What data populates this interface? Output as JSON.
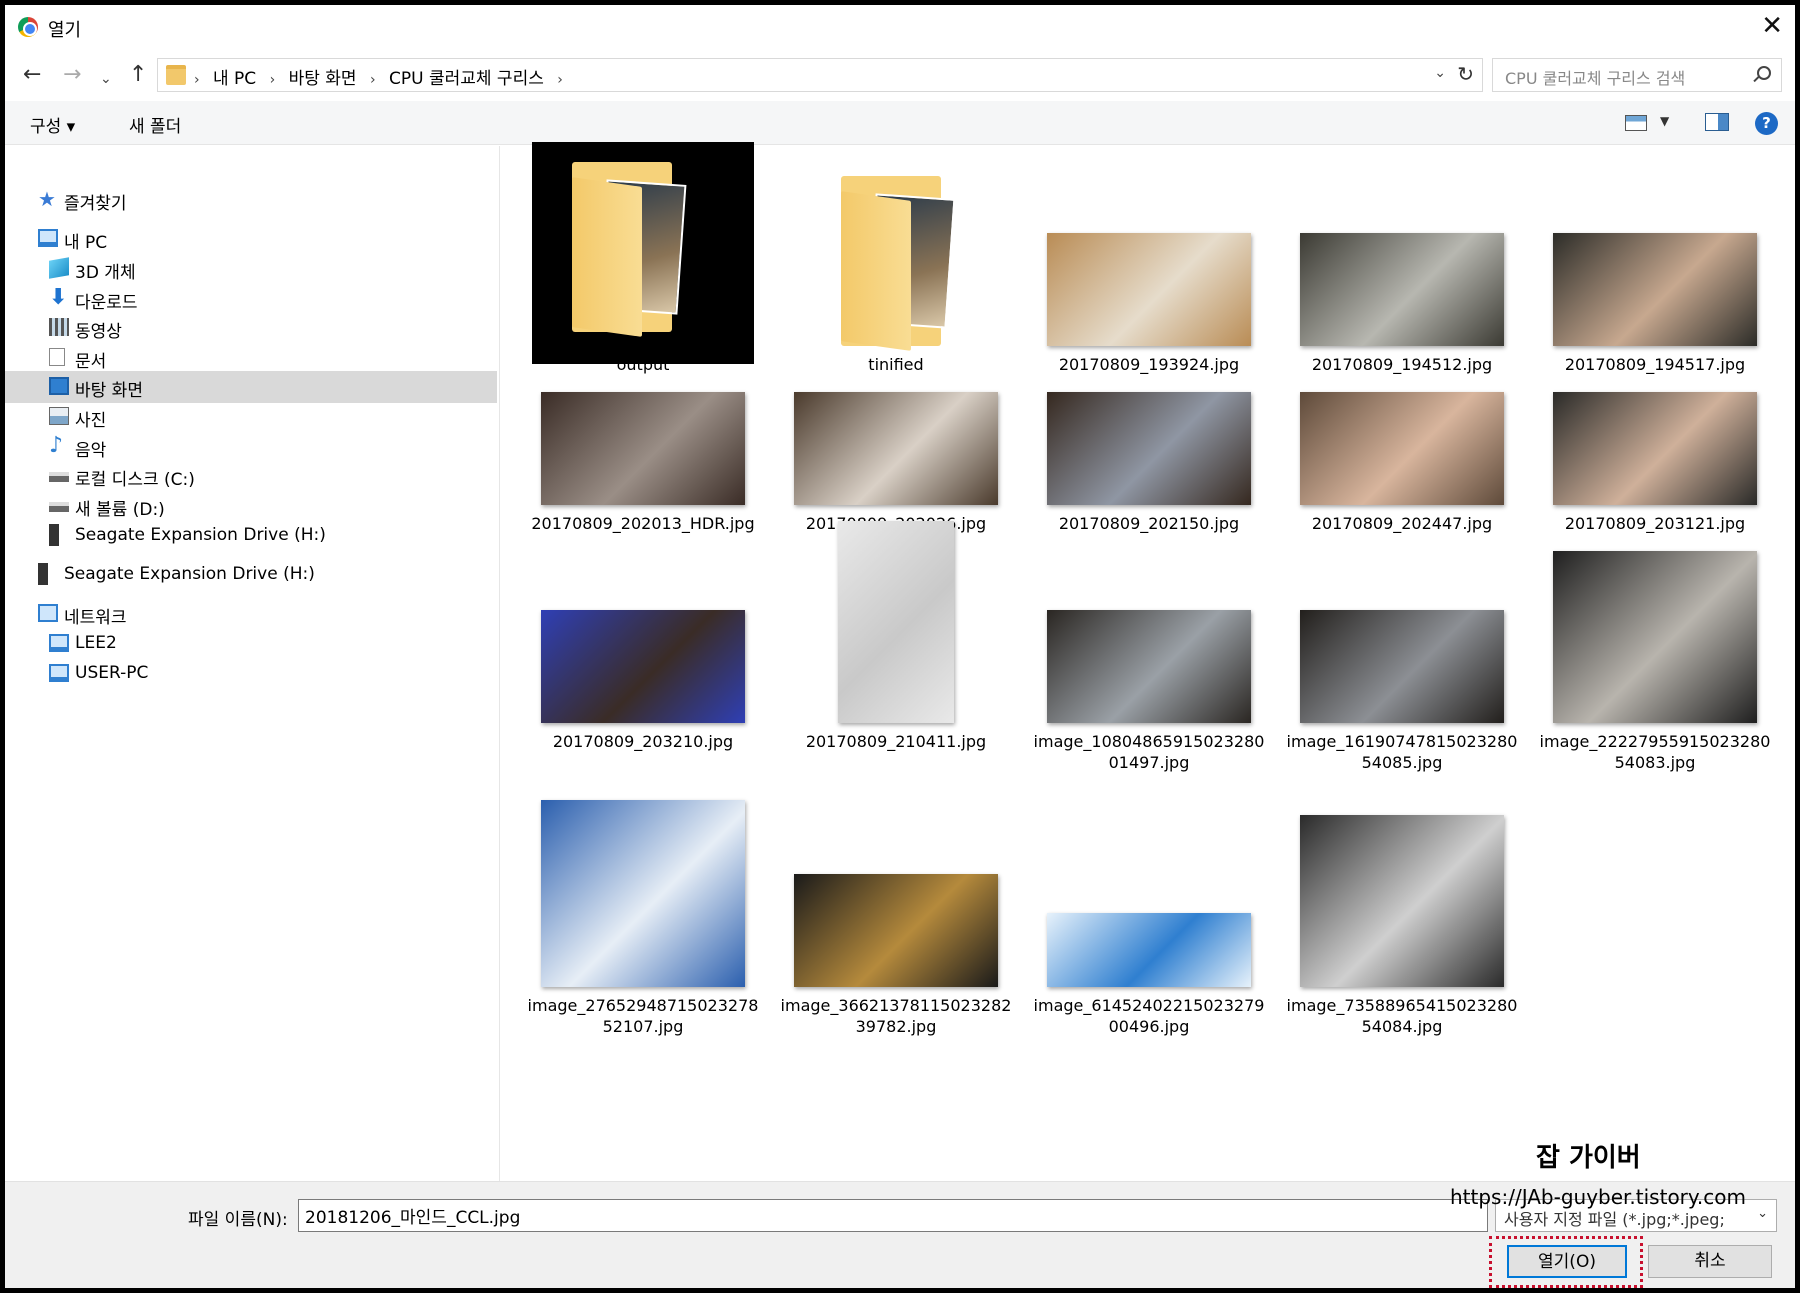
{
  "window": {
    "title": "열기",
    "app_icon": "chrome-icon",
    "close_glyph": "✕"
  },
  "address_bar": {
    "crumbs": [
      "내 PC",
      "바탕 화면",
      "CPU 쿨러교체 구리스"
    ],
    "separator": "›",
    "search_placeholder": "CPU 쿨러교체 구리스 검색"
  },
  "toolbar": {
    "organize_label": "구성 ▾",
    "new_folder_label": "새 폴더",
    "help_glyph": "?"
  },
  "sidebar": {
    "items": [
      {
        "label": "즐겨찾기",
        "icon": "star-icon",
        "indent": 0
      },
      {
        "label": "내 PC",
        "icon": "computer-icon",
        "indent": 0
      },
      {
        "label": "3D 개체",
        "icon": "3d-objects-icon",
        "indent": 1
      },
      {
        "label": "다운로드",
        "icon": "download-icon",
        "indent": 1
      },
      {
        "label": "동영상",
        "icon": "video-icon",
        "indent": 1
      },
      {
        "label": "문서",
        "icon": "document-icon",
        "indent": 1
      },
      {
        "label": "바탕 화면",
        "icon": "desktop-icon",
        "indent": 1,
        "selected": true
      },
      {
        "label": "사진",
        "icon": "pictures-icon",
        "indent": 1
      },
      {
        "label": "음악",
        "icon": "music-icon",
        "indent": 1
      },
      {
        "label": "로컬 디스크 (C:)",
        "icon": "disk-icon",
        "indent": 1
      },
      {
        "label": "새 볼륨 (D:)",
        "icon": "disk-icon",
        "indent": 1
      },
      {
        "label": "Seagate Expansion Drive (H:)",
        "icon": "drive-icon",
        "indent": 1
      },
      {
        "label": "Seagate Expansion Drive (H:)",
        "icon": "drive-icon",
        "indent": 0
      },
      {
        "label": "네트워크",
        "icon": "network-icon",
        "indent": 0
      },
      {
        "label": "LEE2",
        "icon": "computer-icon",
        "indent": 1
      },
      {
        "label": "USER-PC",
        "icon": "computer-icon",
        "indent": 1
      }
    ]
  },
  "files": [
    {
      "name": "output",
      "type": "folder",
      "dark": true
    },
    {
      "name": "tinified",
      "type": "folder"
    },
    {
      "name": "20170809_193924.jpg",
      "type": "image",
      "colors": [
        "#b98c55",
        "#e6dccb"
      ],
      "shape": "landscape"
    },
    {
      "name": "20170809_194512.jpg",
      "type": "image",
      "colors": [
        "#3b3a33",
        "#b7b7b0"
      ],
      "shape": "landscape"
    },
    {
      "name": "20170809_194517.jpg",
      "type": "image",
      "colors": [
        "#2c2c28",
        "#c7a88f"
      ],
      "shape": "landscape"
    },
    {
      "name": "20170809_202013_HDR.jpg",
      "type": "image",
      "colors": [
        "#3a2c26",
        "#9a8e86"
      ],
      "shape": "landscape"
    },
    {
      "name": "20170809_202026.jpg",
      "type": "image",
      "colors": [
        "#4a3a2c",
        "#d9d0c6"
      ],
      "shape": "landscape"
    },
    {
      "name": "20170809_202150.jpg",
      "type": "image",
      "colors": [
        "#35281f",
        "#8f96a3"
      ],
      "shape": "landscape"
    },
    {
      "name": "20170809_202447.jpg",
      "type": "image",
      "colors": [
        "#5e4a3a",
        "#d8b59d"
      ],
      "shape": "landscape"
    },
    {
      "name": "20170809_203121.jpg",
      "type": "image",
      "colors": [
        "#2a2a28",
        "#cfb09a"
      ],
      "shape": "landscape"
    },
    {
      "name": "20170809_203210.jpg",
      "type": "image",
      "colors": [
        "#2f3fb5",
        "#3a2c26"
      ],
      "shape": "landscape"
    },
    {
      "name": "20170809_210411.jpg",
      "type": "image",
      "colors": [
        "#e9e9e9",
        "#c9c9c9"
      ],
      "shape": "portrait"
    },
    {
      "name": "image_1080486591502328001497.jpg",
      "type": "image",
      "colors": [
        "#2a2622",
        "#9aa0a6"
      ],
      "shape": "landscape"
    },
    {
      "name": "image_1619074781502328054085.jpg",
      "type": "image",
      "colors": [
        "#221f1c",
        "#8c8f94"
      ],
      "shape": "landscape"
    },
    {
      "name": "image_2222795591502328054083.jpg",
      "type": "image",
      "colors": [
        "#1f1f1f",
        "#b8b4ad"
      ],
      "shape": "square"
    },
    {
      "name": "image_2765294871502327852107.jpg",
      "type": "image",
      "colors": [
        "#2b5fae",
        "#e7eef6"
      ],
      "shape": "tall"
    },
    {
      "name": "image_3662137811502328239782.jpg",
      "type": "image",
      "colors": [
        "#1a1a1a",
        "#b58a3c"
      ],
      "shape": "landscape"
    },
    {
      "name": "image_6145240221502327900496.jpg",
      "type": "image",
      "colors": [
        "#e7f2fb",
        "#2f7fd0"
      ],
      "shape": "strip"
    },
    {
      "name": "image_7358896541502328054084.jpg",
      "type": "image",
      "colors": [
        "#2a2a2a",
        "#cfcfcf"
      ],
      "shape": "square"
    }
  ],
  "bottom": {
    "filename_label": "파일 이름(N):",
    "filename_value": "20181206_마인드_CCL.jpg",
    "filetype_value": "사용자 지정 파일 (*.jpg;*.jpeg;",
    "open_label": "열기(O)",
    "cancel_label": "취소"
  },
  "watermark": {
    "title": "잡 가이버",
    "url": "https://JAb-guyber.tistory.com"
  }
}
